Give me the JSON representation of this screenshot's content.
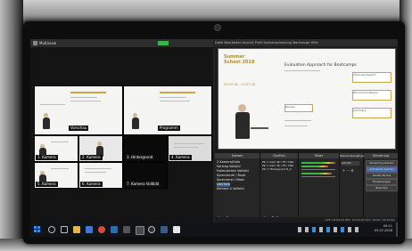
{
  "left_window": {
    "title": "Multiview"
  },
  "multiview": {
    "tiles": [
      {
        "label": "Vorschau"
      },
      {
        "label": "Programm"
      },
      {
        "label": "1. Kamera"
      },
      {
        "label": "2. Kamera"
      },
      {
        "label": "3. Hintergrund"
      },
      {
        "label": "4. Kamera"
      },
      {
        "label": "5. Kamera"
      },
      {
        "label": "6. Kamera"
      },
      {
        "label": "7. Kamera Vollbild"
      }
    ]
  },
  "right_window": {
    "tabs": "Datei   Bearbeiten   Ansicht   Profil   Szenensammlung   Werkzeuge   Hilfe",
    "preview": {
      "brand": "Summer School 2018",
      "title": "Evaluation Approach for Bootcamps",
      "date": "03.07.18 – 07.07.18",
      "box1": "Interview Report",
      "box2": "Recommendations",
      "box3": "Review",
      "box4": "Summary"
    }
  },
  "panels": {
    "scenes": {
      "header": "Szenen",
      "items": [
        "2 Kamera/Folie",
        "Vortrag Vollbild",
        "Folienstellen Vollbild",
        "Sprecherrei / Modr",
        "Sprecherei / Modr",
        "Leerfolie",
        "Kamera 4 Vollbild"
      ]
    },
    "sources": {
      "header": "Quellen",
      "items": [
        "PK = Cam 4K / Ffl / Dbb",
        "PK = Cam 4K / Ffl / Dbb",
        "PK = Hintergrund R_4"
      ]
    },
    "mixer": {
      "header": "Mixer"
    },
    "transitions": {
      "header": "Szenenübergänge",
      "select": "Schnitt"
    },
    "controls": {
      "header": "Steuerung",
      "buttons": [
        "Streaming starten",
        "Aufnahme starten",
        "Studio-Modus",
        "Einstellungen",
        "Beenden"
      ]
    },
    "status": "LIVE: 00:00:00   REC: 00:00:00   CPU: 18.6%, 30.00 fps"
  },
  "taskbar": {
    "time": "09:11",
    "date": "03.07.2018"
  }
}
